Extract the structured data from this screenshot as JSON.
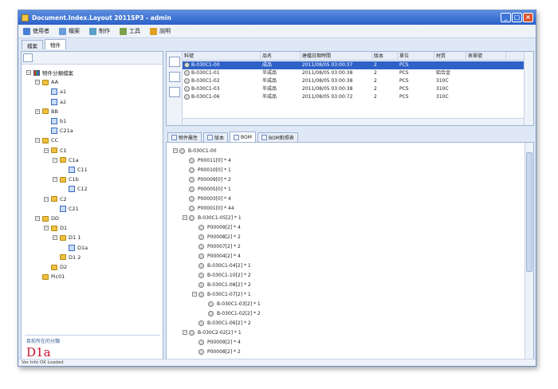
{
  "window": {
    "title": "Document.Index.Layout 2011SP3 - admin"
  },
  "menu": [
    {
      "label": "使用者",
      "icon": "user-icon",
      "color": "#4a7fd4"
    },
    {
      "label": "檔案",
      "icon": "file-icon",
      "color": "#6a9bd8"
    },
    {
      "label": "制作",
      "icon": "tool-icon",
      "color": "#5aa0c8"
    },
    {
      "label": "工具",
      "icon": "wrench-icon",
      "color": "#7aa04a"
    },
    {
      "label": "說明",
      "icon": "help-icon",
      "color": "#e0a020"
    }
  ],
  "top_tabs": [
    "檔案",
    "物件"
  ],
  "tree": [
    {
      "label": "物件分類檔案",
      "depth": 0,
      "toggle": "−",
      "icon": "folder-stripe"
    },
    {
      "label": "AA",
      "depth": 1,
      "toggle": "−",
      "icon": "folder"
    },
    {
      "label": "a1",
      "depth": 2,
      "toggle": "",
      "icon": "doc"
    },
    {
      "label": "a2",
      "depth": 2,
      "toggle": "",
      "icon": "doc"
    },
    {
      "label": "BB",
      "depth": 1,
      "toggle": "−",
      "icon": "folder"
    },
    {
      "label": "b1",
      "depth": 2,
      "toggle": "",
      "icon": "doc"
    },
    {
      "label": "C21a",
      "depth": 2,
      "toggle": "",
      "icon": "doc"
    },
    {
      "label": "CC",
      "depth": 1,
      "toggle": "−",
      "icon": "folder"
    },
    {
      "label": "C1",
      "depth": 2,
      "toggle": "−",
      "icon": "folder"
    },
    {
      "label": "C1a",
      "depth": 3,
      "toggle": "−",
      "icon": "folder"
    },
    {
      "label": "C11",
      "depth": 4,
      "toggle": "",
      "icon": "doc"
    },
    {
      "label": "C1b",
      "depth": 3,
      "toggle": "−",
      "icon": "folder"
    },
    {
      "label": "C12",
      "depth": 4,
      "toggle": "",
      "icon": "doc"
    },
    {
      "label": "C2",
      "depth": 2,
      "toggle": "−",
      "icon": "folder"
    },
    {
      "label": "C21",
      "depth": 3,
      "toggle": "",
      "icon": "doc"
    },
    {
      "label": "DD",
      "depth": 1,
      "toggle": "−",
      "icon": "folder"
    },
    {
      "label": "D1",
      "depth": 2,
      "toggle": "−",
      "icon": "folder"
    },
    {
      "label": "D1 1",
      "depth": 3,
      "toggle": "−",
      "icon": "folder"
    },
    {
      "label": "D1a",
      "depth": 4,
      "toggle": "",
      "icon": "doc"
    },
    {
      "label": "D1 2",
      "depth": 3,
      "toggle": "",
      "icon": "folder"
    },
    {
      "label": "D2",
      "depth": 2,
      "toggle": "",
      "icon": "folder"
    },
    {
      "label": "Pic01",
      "depth": 1,
      "toggle": "",
      "icon": "folder"
    }
  ],
  "info": {
    "caption": "目前所在的分類",
    "value": "D1a"
  },
  "grid": {
    "columns": [
      "料號",
      "品名",
      "建檔日期時間",
      "版本",
      "單位",
      "材質",
      "表單號"
    ],
    "rows": [
      [
        "B-030C1-00",
        "成品",
        "2011/08/05 03:00:37",
        "2",
        "PCS",
        "",
        ""
      ],
      [
        "B-030C1-01",
        "半成品",
        "2011/08/05 03:00:38",
        "2",
        "PCS",
        "鋁合金",
        ""
      ],
      [
        "B-030C1-02",
        "半成品",
        "2011/08/05 03:00:38",
        "2",
        "PCS",
        "310C",
        ""
      ],
      [
        "B-030C1-03",
        "半成品",
        "2011/08/05 03:00:38",
        "2",
        "PCS",
        "310C",
        ""
      ],
      [
        "B-030C1-06",
        "半成品",
        "2011/08/05 03:00:72",
        "2",
        "PCS",
        "310C",
        ""
      ]
    ]
  },
  "sub_tabs": [
    "物件屬性",
    "版本",
    "BOM",
    "BOM對照表"
  ],
  "bom": [
    {
      "label": "B-030C1-00",
      "depth": 0,
      "toggle": "−"
    },
    {
      "label": "P00011[0] * 4",
      "depth": 1,
      "toggle": ""
    },
    {
      "label": "P00010[0] * 1",
      "depth": 1,
      "toggle": ""
    },
    {
      "label": "P00009[0] * 2",
      "depth": 1,
      "toggle": ""
    },
    {
      "label": "P00005[0] * 1",
      "depth": 1,
      "toggle": ""
    },
    {
      "label": "P00003[0] * 4",
      "depth": 1,
      "toggle": ""
    },
    {
      "label": "P00001[0] * 44",
      "depth": 1,
      "toggle": ""
    },
    {
      "label": "B-030C1-05[2] * 1",
      "depth": 1,
      "toggle": "−"
    },
    {
      "label": "P00009[2] * 4",
      "depth": 2,
      "toggle": ""
    },
    {
      "label": "P00008[2] * 2",
      "depth": 2,
      "toggle": ""
    },
    {
      "label": "P00007[2] * 2",
      "depth": 2,
      "toggle": ""
    },
    {
      "label": "P00004[2] * 4",
      "depth": 2,
      "toggle": ""
    },
    {
      "label": "B-030C1-04[2] * 1",
      "depth": 2,
      "toggle": ""
    },
    {
      "label": "B-030C1-10[2] * 2",
      "depth": 2,
      "toggle": ""
    },
    {
      "label": "B-030C1-08[2] * 2",
      "depth": 2,
      "toggle": ""
    },
    {
      "label": "B-030C1-07[2] * 1",
      "depth": 2,
      "toggle": "−"
    },
    {
      "label": "B-030C1-03[2] * 1",
      "depth": 3,
      "toggle": ""
    },
    {
      "label": "B-030C1-02[2] * 2",
      "depth": 3,
      "toggle": ""
    },
    {
      "label": "B-030C1-06[2] * 2",
      "depth": 2,
      "toggle": ""
    },
    {
      "label": "B-030C2-02[2] * 1",
      "depth": 1,
      "toggle": "−"
    },
    {
      "label": "P00009[2] * 4",
      "depth": 2,
      "toggle": ""
    },
    {
      "label": "P00008[2] * 2",
      "depth": 2,
      "toggle": ""
    }
  ],
  "status": {
    "text": "Ver Info OK Loaded"
  }
}
